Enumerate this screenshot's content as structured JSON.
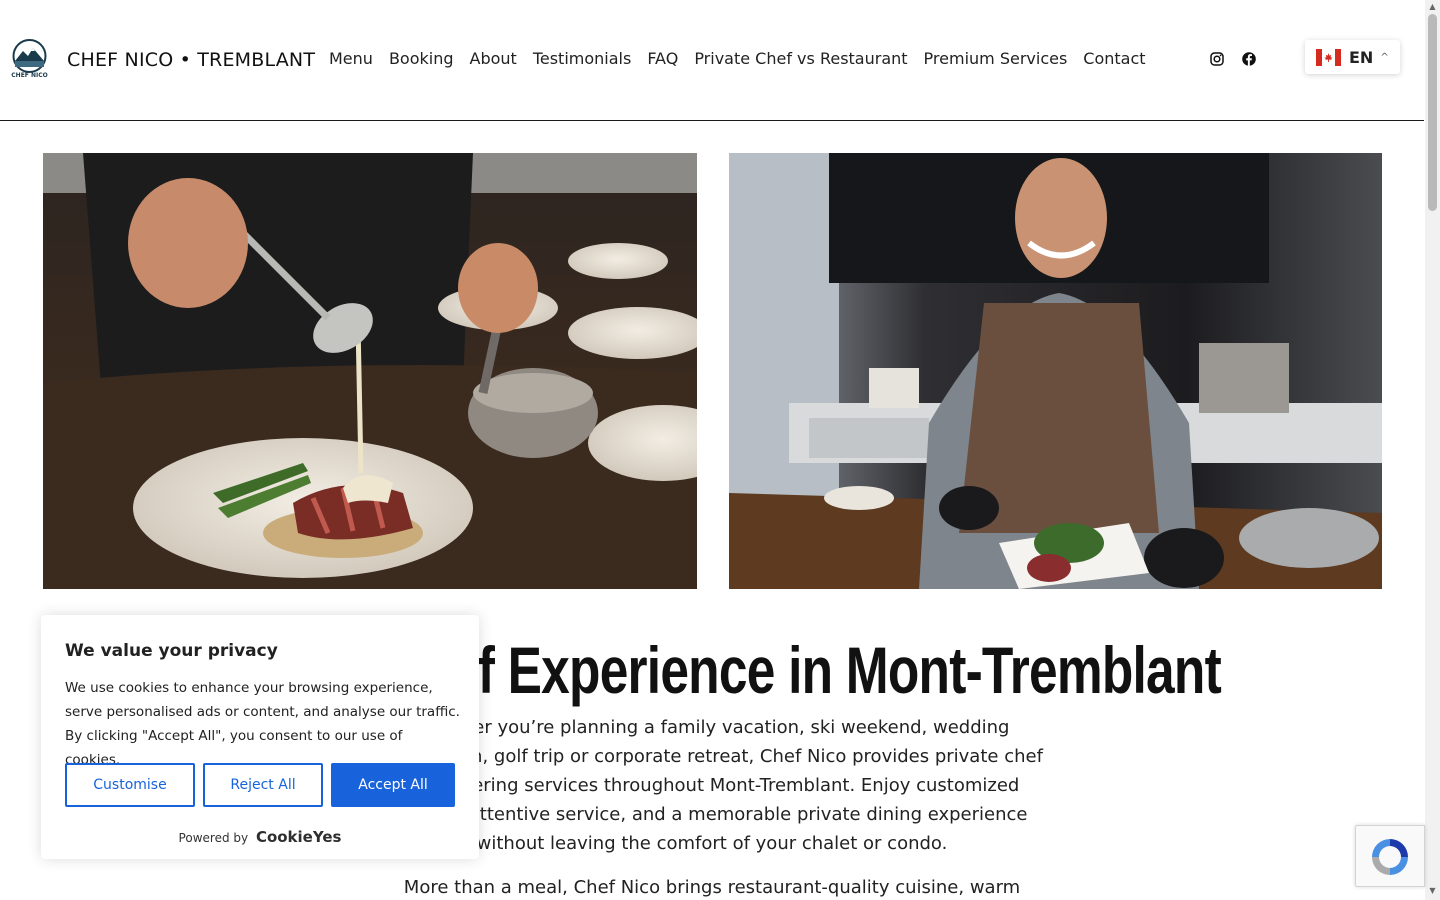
{
  "brand": {
    "name": "CHEF NICO • TREMBLANT",
    "logo_text": "CHEF NICO"
  },
  "nav": {
    "items": [
      {
        "label": "Menu"
      },
      {
        "label": "Booking"
      },
      {
        "label": "About"
      },
      {
        "label": "Testimonials"
      },
      {
        "label": "FAQ"
      },
      {
        "label": "Private Chef vs Restaurant"
      },
      {
        "label": "Premium Services"
      },
      {
        "label": "Contact"
      }
    ]
  },
  "social": {
    "instagram_icon": "instagram-icon",
    "facebook_icon": "facebook-icon"
  },
  "language": {
    "code": "EN",
    "flag": "canada-flag-icon"
  },
  "hero": {
    "title": "Private Chef Experience in Mont-Tremblant",
    "paragraph1": "Whether you’re planning a family vacation, ski weekend, wedding celebration, golf trip or corporate retreat, Chef Nico provides private chef and catering services throughout Mont-Tremblant. Enjoy customized menus, attentive service, and a memorable private dining experience without leaving the comfort of your chalet or condo.",
    "paragraph2": "More than a meal, Chef Nico brings restaurant-quality cuisine, warm hospitality,"
  },
  "cookie": {
    "title": "We value your privacy",
    "body": "We use cookies to enhance your browsing experience, serve personalised ads or content, and analyse our traffic. By clicking \"Accept All\", you consent to our use of cookies.",
    "customise": "Customise",
    "reject": "Reject All",
    "accept": "Accept All",
    "powered_by": "Powered by",
    "provider": "CookieYes"
  },
  "colors": {
    "accent": "#1863dc",
    "text": "#1a1a1a",
    "canada_red": "#d52b1e"
  }
}
